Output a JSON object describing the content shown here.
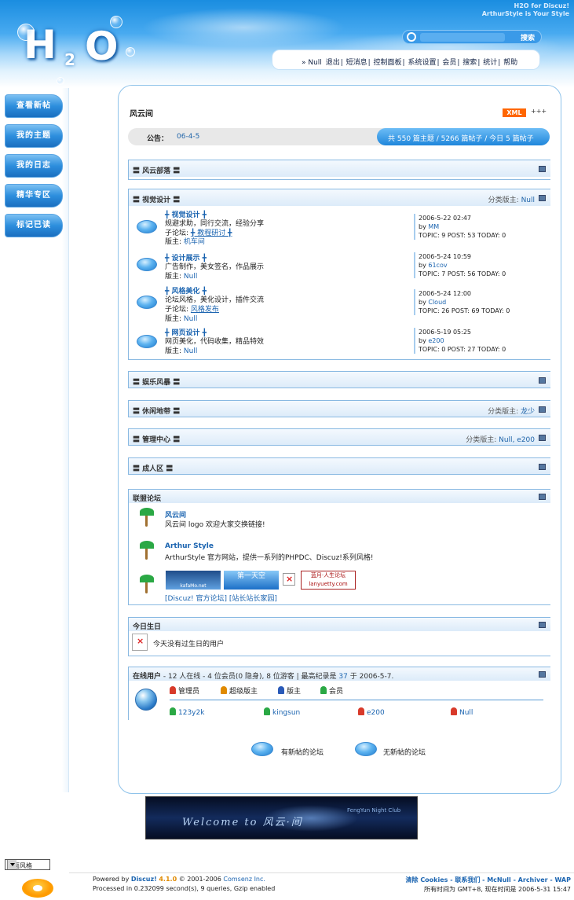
{
  "header": {
    "tagline_line1": "H2O for Discuz!",
    "tagline_line2": "ArthurStyle is Your Style",
    "logo_h": "H",
    "logo_2": "2",
    "logo_o": "O",
    "search_button": "搜索",
    "nav": [
      "» Null",
      "退出",
      "短消息",
      "控制面板",
      "系统设置",
      "会员",
      "搜索",
      "统计",
      "帮助"
    ]
  },
  "sidebar": {
    "items": [
      {
        "label": "查看新帖"
      },
      {
        "label": "我的主题"
      },
      {
        "label": "我的日志"
      },
      {
        "label": "精华专区"
      },
      {
        "label": "标记已读"
      }
    ]
  },
  "main": {
    "forum_title": "风云间",
    "xml_badge": "XML",
    "xml_arrows": "+++",
    "notice_label": "公告：",
    "notice_date": "06-4-5",
    "stats_pill": "共 550 篇主题 / 5266 篇帖子 / 今日 5 篇帖子",
    "categories": [
      {
        "title": "〓 风云部落 〓",
        "moderator_label": "",
        "moderators": ""
      },
      {
        "title": "〓 视觉设计 〓",
        "moderator_label": "分类版主:",
        "moderators": "Null"
      },
      {
        "title": "〓 娱乐风暴 〓",
        "moderator_label": "",
        "moderators": ""
      },
      {
        "title": "〓 休闲地带 〓",
        "moderator_label": "分类版主:",
        "moderators": "龙少"
      },
      {
        "title": "〓 管理中心 〓",
        "moderator_label": "分类版主:",
        "moderators": "Null, e200"
      },
      {
        "title": "〓 成人区 〓",
        "moderator_label": "",
        "moderators": ""
      }
    ],
    "forums": [
      {
        "name": "╋ 视觉设计 ╋",
        "desc": "规避求助，同行交流，经验分享",
        "sub_label": "子论坛:",
        "sub": "╋ 教程研讨 ╋",
        "mod_label": "版主:",
        "mod": "机车间",
        "last_date": "2006-5-22 02:47",
        "last_by": "MM",
        "last_stats": "TOPIC: 9  POST: 53  TODAY: 0"
      },
      {
        "name": "╋ 设计展示 ╋",
        "desc": "广告制作，美女签名，作品展示",
        "sub_label": "",
        "sub": "",
        "mod_label": "版主:",
        "mod": "Null",
        "last_date": "2006-5-24 10:59",
        "last_by": "61cov",
        "last_stats": "TOPIC: 7  POST: 56  TODAY: 0"
      },
      {
        "name": "╋ 风格美化 ╋",
        "desc": "论坛风格，美化设计，插件交流",
        "sub_label": "子论坛:",
        "sub": "风格发布",
        "mod_label": "版主:",
        "mod": "Null",
        "last_date": "2006-5-24 12:00",
        "last_by": "Cloud",
        "last_stats": "TOPIC: 26  POST: 69  TODAY: 0"
      },
      {
        "name": "╋ 网页设计 ╋",
        "desc": "网页美化，代码收集，精品特效",
        "sub_label": "",
        "sub": "",
        "mod_label": "版主:",
        "mod": "Null",
        "last_date": "2006-5-19 05:25",
        "last_by": "e200",
        "last_stats": "TOPIC: 0  POST: 27  TODAY: 0"
      }
    ],
    "last_by_label": "by",
    "links_title": "联盟论坛",
    "links": [
      {
        "name": "风云间",
        "desc": "风云间 logo 欢迎大家交换链接!"
      },
      {
        "name": "Arthur Style",
        "desc": "ArthurStyle 官方网站，提供一系列的PHPDC、Discuz!系列风格!"
      }
    ],
    "link_banners": {
      "b1": "kafaMo.net",
      "b2": "第一天空",
      "b3": "蓝月·人生论坛 lanyuetty.com"
    },
    "link_text_row": "[Discuz! 官方论坛] [站长站长家园]",
    "birthday_title": "今日生日",
    "birthday_text": "今天没有过生日的用户",
    "online_title_label": "在线用户",
    "online_title_text": "- 12 人在线 - 4 位会员(0 隐身), 8 位游客 | 最高纪录是",
    "online_record": "37",
    "online_record_date": "于 2006-5-7.",
    "legend": [
      {
        "label": "管理员",
        "color": "#d83a2a"
      },
      {
        "label": "超级版主",
        "color": "#e08a00"
      },
      {
        "label": "版主",
        "color": "#2a5ab8"
      },
      {
        "label": "会员",
        "color": "#2aa844"
      }
    ],
    "online_users": [
      {
        "name": "123y2k",
        "color": "#2aa844"
      },
      {
        "name": "kingsun",
        "color": "#2aa844"
      },
      {
        "name": "e200",
        "color": "#d83a2a"
      },
      {
        "name": "Null",
        "color": "#d83a2a"
      }
    ],
    "legend_new": "有新帖的论坛",
    "legend_nonew": "无新帖的论坛"
  },
  "footer": {
    "welcome_text": "Welcome to 风云·间",
    "welcome_sub": "FengYun Night Club",
    "style_select": "界面风格",
    "powered": "Powered by",
    "brand": "Discuz!",
    "version": "4.1.0",
    "copyright": "© 2001-2006",
    "company": "Comsenz Inc.",
    "processed": "Processed in 0.232099 second(s), 9 queries, Gzip enabled",
    "right_links": "清除 Cookies - 联系我们 - McNull - Archiver - WAP",
    "time_text": "所有时间为 GMT+8, 现在时间是 2006-5-31 15:47"
  }
}
